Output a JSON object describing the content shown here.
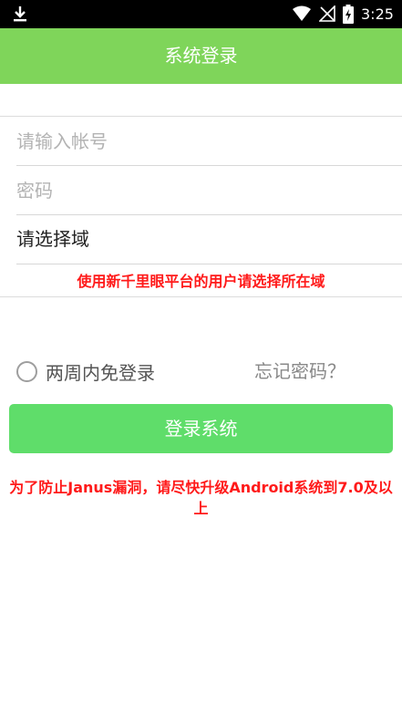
{
  "status_bar": {
    "time": "3:25",
    "icons": [
      "download-icon",
      "wifi-icon",
      "signal-off-icon",
      "battery-charging-icon"
    ]
  },
  "header": {
    "title": "系统登录"
  },
  "form": {
    "account_placeholder": "请输入帐号",
    "account_value": "",
    "password_placeholder": "密码",
    "password_value": "",
    "domain_label": "请选择域",
    "hint": "使用新千里眼平台的用户请选择所在域"
  },
  "remember": {
    "label": "两周内免登录",
    "checked": false
  },
  "forgot_password": "忘记密码？",
  "login_button": "登录系统",
  "warning": "为了防止Janus漏洞，请尽快升级Android系统到7.0及以上",
  "colors": {
    "header_bg": "#7fd55a",
    "button_bg": "#5fdd6a",
    "warning_text": "#ff1a1a"
  }
}
